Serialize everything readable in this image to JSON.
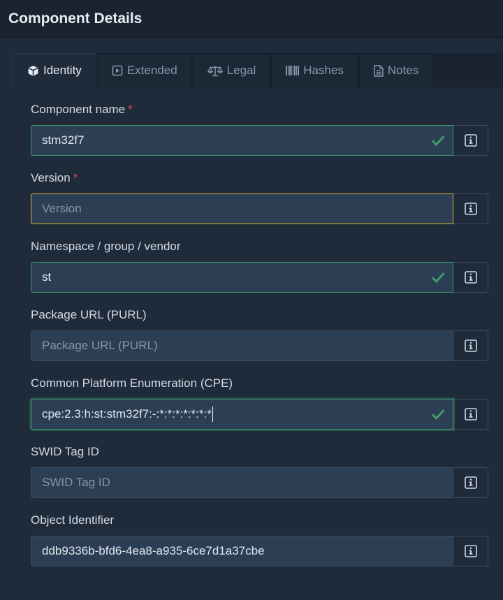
{
  "header": {
    "title": "Component Details"
  },
  "tabs": [
    {
      "label": "Identity",
      "icon": "cube-icon",
      "active": true
    },
    {
      "label": "Extended",
      "icon": "play-square-icon"
    },
    {
      "label": "Legal",
      "icon": "scale-icon"
    },
    {
      "label": "Hashes",
      "icon": "barcode-icon"
    },
    {
      "label": "Notes",
      "icon": "document-icon"
    }
  ],
  "fields": {
    "name": {
      "label": "Component name",
      "required": "*",
      "value": "stm32f7"
    },
    "version": {
      "label": "Version",
      "required": "*",
      "placeholder": "Version"
    },
    "namespace": {
      "label": "Namespace / group / vendor",
      "value": "st"
    },
    "purl": {
      "label": "Package URL (PURL)",
      "placeholder": "Package URL (PURL)"
    },
    "cpe": {
      "label": "Common Platform Enumeration (CPE)",
      "value": "cpe:2.3:h:st:stm32f7:-:*:*:*:*:*:*:*"
    },
    "swid": {
      "label": "SWID Tag ID",
      "placeholder": "SWID Tag ID"
    },
    "oid": {
      "label": "Object Identifier",
      "value": "ddb9336b-bfd6-4ea8-a935-6ce7d1a37cbe"
    }
  },
  "colors": {
    "valid": "#3e9d6a",
    "warning": "#d7b233",
    "required": "#e0465a"
  }
}
